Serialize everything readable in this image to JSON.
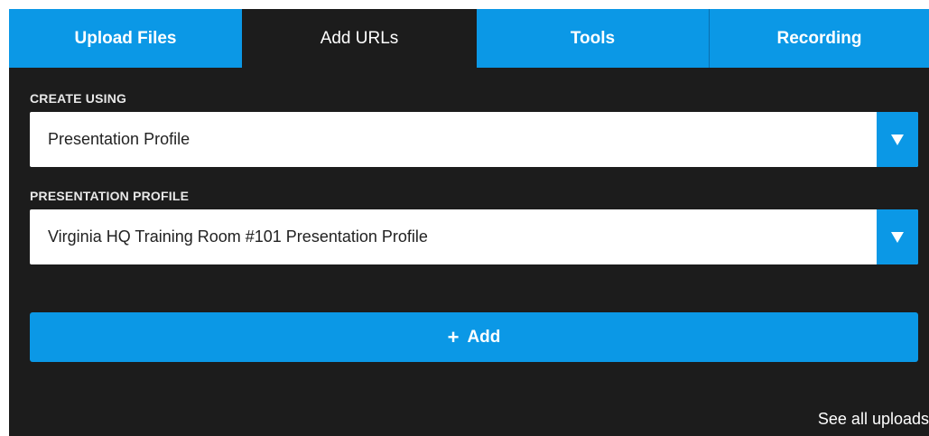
{
  "tabs": [
    {
      "label": "Upload Files"
    },
    {
      "label": "Add URLs"
    },
    {
      "label": "Tools"
    },
    {
      "label": "Recording"
    }
  ],
  "create_using": {
    "label": "CREATE USING",
    "value": "Presentation Profile"
  },
  "presentation_profile": {
    "label": "PRESENTATION PROFILE",
    "value": "Virginia HQ Training Room #101 Presentation Profile"
  },
  "add_button": {
    "icon": "plus-icon",
    "label": "Add"
  },
  "see_all_link": "See all uploads",
  "colors": {
    "accent": "#0b98e6",
    "panel": "#1c1c1c",
    "field": "#ffffff"
  }
}
